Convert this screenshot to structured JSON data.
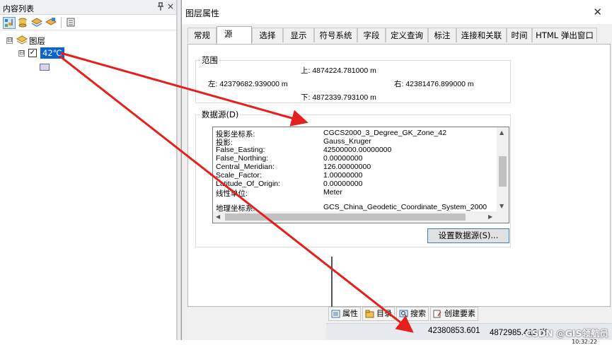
{
  "toc": {
    "title": "内容列表",
    "pin_icon": "pin-icon",
    "close_glyph": "×",
    "tools": [
      "list-by-drawing-order-icon",
      "list-by-source-icon",
      "list-by-visibility-icon",
      "list-by-selection-icon",
      "options-icon"
    ],
    "layers_group": {
      "label": "图层",
      "expander": "⊟"
    },
    "layer": {
      "name": "42℃",
      "checked": true,
      "expander": "⊟",
      "symbol_color": "#d9d3ec"
    }
  },
  "dialog": {
    "title": "图层属性",
    "close_glyph": "✕",
    "tabs": [
      {
        "label": "常规"
      },
      {
        "label": "源",
        "active": true
      },
      {
        "label": "选择"
      },
      {
        "label": "显示"
      },
      {
        "label": "符号系统"
      },
      {
        "label": "字段"
      },
      {
        "label": "定义查询"
      },
      {
        "label": "标注"
      },
      {
        "label": "连接和关联"
      },
      {
        "label": "时间"
      },
      {
        "label": "HTML 弹出窗口"
      }
    ],
    "extent": {
      "legend": "范围",
      "top": "上:  4874224.781000 m",
      "left": "左:  42379682.939000 m",
      "right": "右:  42381476.899000 m",
      "bottom": "下:  4872339.793100 m"
    },
    "datasource": {
      "legend": "数据源(D)",
      "rows": [
        {
          "key": "投影坐标系:",
          "value": "CGCS2000_3_Degree_GK_Zone_42"
        },
        {
          "key": "投影:",
          "value": "Gauss_Kruger"
        },
        {
          "key": "False_Easting:",
          "value": "42500000.00000000"
        },
        {
          "key": "False_Northing:",
          "value": "0.00000000"
        },
        {
          "key": "Central_Meridian:",
          "value": "126.00000000"
        },
        {
          "key": "Scale_Factor:",
          "value": "1.00000000"
        },
        {
          "key": "Latitude_Of_Origin:",
          "value": "0.00000000"
        },
        {
          "key": "线性单位:",
          "value": "Meter"
        },
        {
          "key": "地理坐标系:",
          "value": "GCS_China_Geodetic_Coordinate_System_2000"
        }
      ],
      "set_button": "设置数据源(S)..."
    }
  },
  "bottom_tabs": [
    {
      "label": "属性",
      "icon": "properties-icon"
    },
    {
      "label": "目录",
      "icon": "catalog-icon"
    },
    {
      "label": "搜索",
      "icon": "search-icon"
    },
    {
      "label": "创建要素",
      "icon": "create-features-icon"
    }
  ],
  "statusbar": {
    "x": "42380853.601",
    "y": "4872985.412 米",
    "watermark": "CSDN @GIS领航员",
    "peek": "10:32:22"
  },
  "colors": {
    "arrow": "#e5201c",
    "selection": "#0a64d6",
    "active_border": "#3c7fb1"
  }
}
